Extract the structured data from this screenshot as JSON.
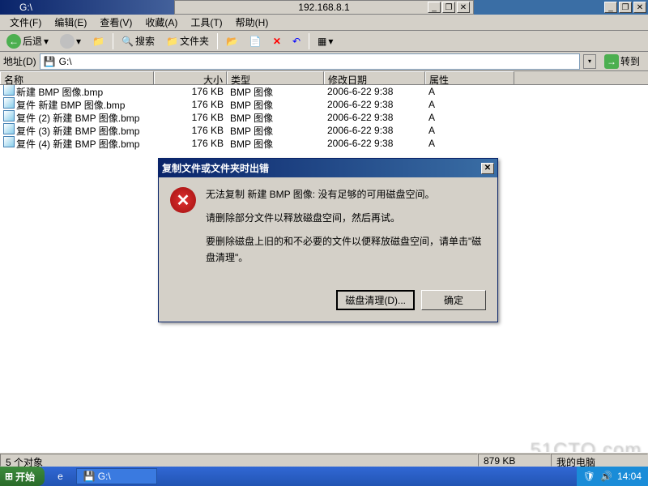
{
  "window": {
    "title": "G:\\",
    "remote_ip": "192.168.8.1"
  },
  "menu": {
    "file": "文件(F)",
    "edit": "编辑(E)",
    "view": "查看(V)",
    "favorites": "收藏(A)",
    "tools": "工具(T)",
    "help": "帮助(H)"
  },
  "toolbar": {
    "back": "后退",
    "search": "搜索",
    "folders": "文件夹"
  },
  "addressbar": {
    "label": "地址(D)",
    "path": "G:\\",
    "go": "转到"
  },
  "columns": {
    "name": "名称",
    "size": "大小",
    "type": "类型",
    "date": "修改日期",
    "attr": "属性"
  },
  "files": [
    {
      "name": "新建 BMP 图像.bmp",
      "size": "176 KB",
      "type": "BMP 图像",
      "date": "2006-6-22 9:38",
      "attr": "A"
    },
    {
      "name": "复件 新建 BMP 图像.bmp",
      "size": "176 KB",
      "type": "BMP 图像",
      "date": "2006-6-22 9:38",
      "attr": "A"
    },
    {
      "name": "复件 (2) 新建 BMP 图像.bmp",
      "size": "176 KB",
      "type": "BMP 图像",
      "date": "2006-6-22 9:38",
      "attr": "A"
    },
    {
      "name": "复件 (3) 新建 BMP 图像.bmp",
      "size": "176 KB",
      "type": "BMP 图像",
      "date": "2006-6-22 9:38",
      "attr": "A"
    },
    {
      "name": "复件 (4) 新建 BMP 图像.bmp",
      "size": "176 KB",
      "type": "BMP 图像",
      "date": "2006-6-22 9:38",
      "attr": "A"
    }
  ],
  "dialog": {
    "title": "复制文件或文件夹时出错",
    "line1": "无法复制 新建 BMP 图像: 没有足够的可用磁盘空间。",
    "line2": "请删除部分文件以释放磁盘空间，然后再试。",
    "line3": "要删除磁盘上旧的和不必要的文件以便释放磁盘空间，请单击\"磁盘清理\"。",
    "btn_cleanup": "磁盘清理(D)...",
    "btn_ok": "确定"
  },
  "statusbar": {
    "objects": "5 个对象",
    "totalsize": "879 KB",
    "location": "我的电脑"
  },
  "taskbar": {
    "start": "开始",
    "task1": "G:\\",
    "clock": "14:04"
  },
  "watermark": "51CTO.com"
}
